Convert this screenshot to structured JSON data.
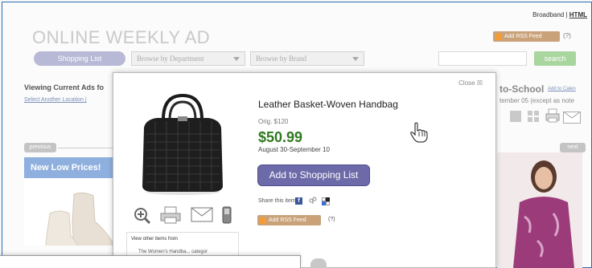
{
  "header": {
    "top_links_broadband": "Broadband |",
    "top_links_html": "HTML",
    "site_title": "ONLINE WEEKLY AD",
    "rss_label": "Add RSS Feed",
    "rss_help": "(?)"
  },
  "nav": {
    "shopping_list": "Shopping List",
    "browse_department": "Browse by Department",
    "browse_brand": "Browse by Brand",
    "search_button": "search",
    "search_value": ""
  },
  "location": {
    "viewing": "Viewing Current Ads fo",
    "select_another": "Select Another Location |"
  },
  "promo": {
    "school_title": "to-School",
    "add_calendar": "Add to Calen",
    "school_sub": "tember 05 (except as note"
  },
  "pager": {
    "previous": "previous",
    "next": "next"
  },
  "left_panel": {
    "banner": "New Low Prices!"
  },
  "modal": {
    "close_label": "Close",
    "product_title": "Leather Basket-Woven Handbag",
    "orig_price": "Orig. $120",
    "sale_price": "$50.99",
    "date_range": "August 30-September 10",
    "add_button": "Add to Shopping List",
    "share_label": "Share this item:",
    "rss_label": "Add RSS Feed",
    "rss_help": "(?)",
    "other_items_label": "View other items from",
    "other_items_sub": "The Women's Handba... categor"
  },
  "colors": {
    "frame_border": "#2a6fb5",
    "add_button_bg": "#6c6aa8",
    "sale_price": "#2f7a1f",
    "rss_bg": "#c9a27a",
    "search_btn": "#a9d59f",
    "banner_bg": "#8fb0de"
  },
  "icons": [
    "zoom-icon",
    "printer-icon",
    "mail-icon",
    "phone-icon",
    "facebook-icon",
    "share-icon",
    "delicious-icon",
    "rss-icon",
    "close-icon",
    "hand-cursor-icon"
  ]
}
